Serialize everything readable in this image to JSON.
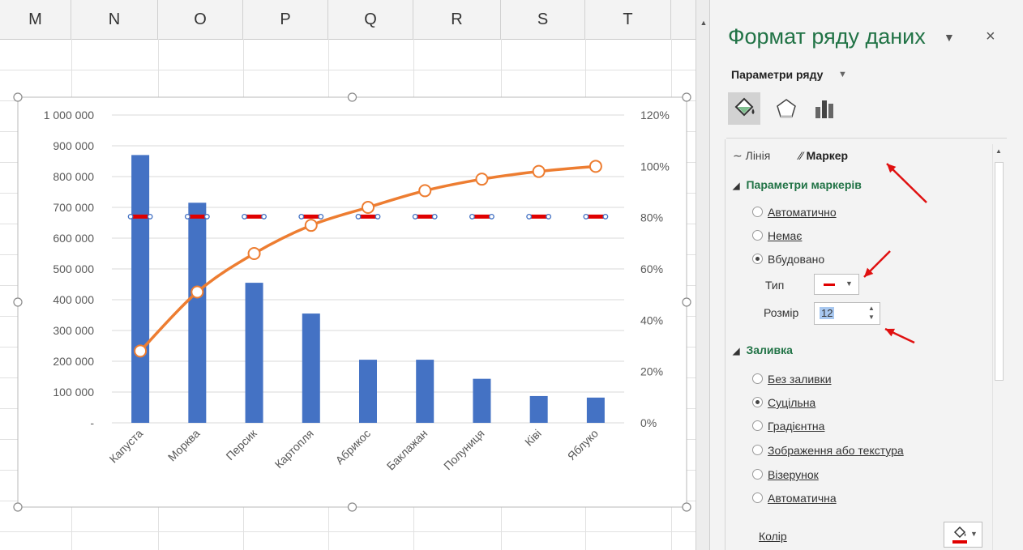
{
  "spreadsheet": {
    "columns": [
      "M",
      "N",
      "O",
      "P",
      "Q",
      "R",
      "S",
      "T"
    ]
  },
  "chart_data": {
    "type": "bar",
    "categories": [
      "Капуста",
      "Морква",
      "Персик",
      "Картопля",
      "Абрикос",
      "Баклажан",
      "Полуниця",
      "Ківі",
      "Яблуко"
    ],
    "series": [
      {
        "type": "bar",
        "axis": "primary",
        "color": "#4472c4",
        "values": [
          870000,
          715000,
          455000,
          355000,
          205000,
          205000,
          143000,
          87000,
          82000
        ]
      },
      {
        "type": "line",
        "axis": "secondary",
        "color": "#ed7d31",
        "marker": "circle",
        "values": [
          0.28,
          0.51,
          0.66,
          0.77,
          0.84,
          0.905,
          0.95,
          0.98,
          1.0
        ]
      },
      {
        "type": "marker",
        "axis": "primary",
        "color": "#e00000",
        "marker": "dash",
        "selected": true,
        "values": [
          670000,
          670000,
          670000,
          670000,
          670000,
          670000,
          670000,
          670000,
          670000
        ]
      }
    ],
    "y_ticks": [
      "1 000 000",
      "900 000",
      "800 000",
      "700 000",
      "600 000",
      "500 000",
      "400 000",
      "300 000",
      "200 000",
      "100 000",
      "-"
    ],
    "y2_ticks": [
      "120%",
      "100%",
      "80%",
      "60%",
      "40%",
      "20%",
      "0%"
    ],
    "ylim": [
      0,
      1000000
    ],
    "y2lim": [
      0,
      1.2
    ],
    "grid": true,
    "legend": "none"
  },
  "pane": {
    "title": "Формат ряду даних",
    "dropdown_icon": "chevron-down-icon",
    "close": "×",
    "series_options": "Параметри ряду",
    "tab_icons": [
      "paint-bucket-icon",
      "pentagon-icon",
      "column-chart-icon"
    ],
    "subtab_line": "Лінія",
    "subtab_marker": "Маркер",
    "marker_section": "Параметри маркерів",
    "marker_options": [
      "Автоматично",
      "Немає",
      "Вбудовано"
    ],
    "type_label": "Тип",
    "size_label": "Розмір",
    "size_value": "12",
    "fill_section": "Заливка",
    "fill_options": [
      "Без заливки",
      "Суцільна",
      "Градієнтна",
      "Зображення або текстура",
      "Візерунок",
      "Автоматична"
    ],
    "color_label": "Колір",
    "accent_color": "#217346",
    "annotation_color": "#e01010"
  }
}
